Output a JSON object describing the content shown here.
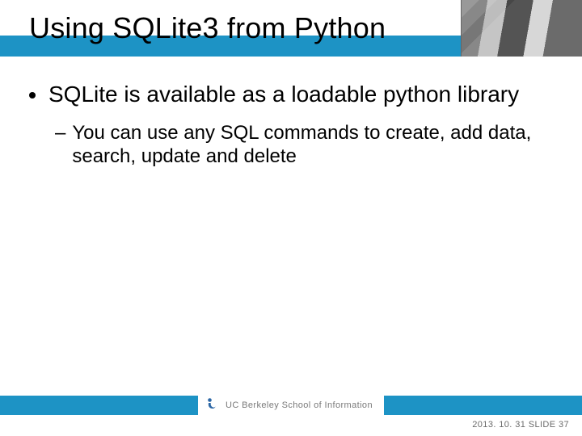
{
  "slide": {
    "title": "Using SQLite3 from Python",
    "bullets": [
      {
        "level": 1,
        "text": "SQLite is available as a loadable python library"
      },
      {
        "level": 2,
        "text": "You can use any SQL commands to create, add data, search, update and delete"
      }
    ],
    "footer": {
      "logo_text": "UC Berkeley School of Information",
      "date": "2013. 10. 31",
      "slide_label": "SLIDE 37"
    },
    "colors": {
      "accent": "#1d93c5"
    }
  }
}
